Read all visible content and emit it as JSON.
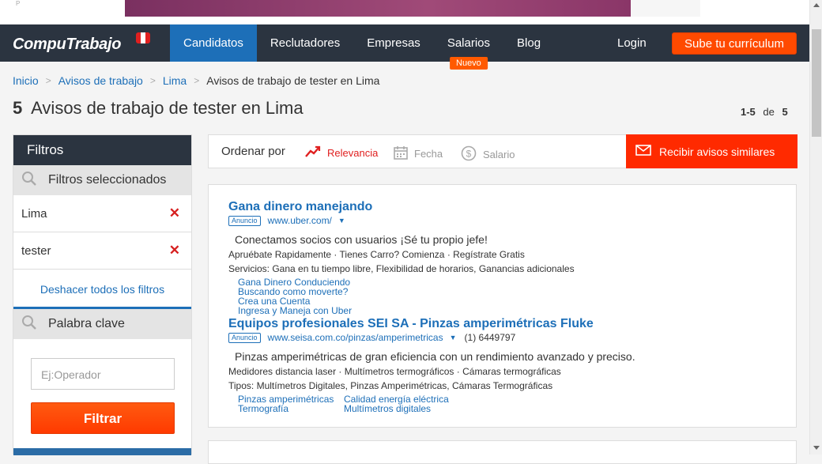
{
  "ad_banner": {
    "label": "P"
  },
  "nav": {
    "logo": "CompuTrabajo",
    "links": [
      {
        "label": "Candidatos"
      },
      {
        "label": "Reclutadores"
      },
      {
        "label": "Empresas"
      },
      {
        "label": "Salarios",
        "badge": "Nuevo"
      },
      {
        "label": "Blog"
      }
    ],
    "login": "Login",
    "cta": "Sube tu currículum"
  },
  "breadcrumb": {
    "items": [
      "Inicio",
      "Avisos de trabajo",
      "Lima"
    ],
    "separator": ">",
    "current": "Avisos de trabajo de tester en Lima"
  },
  "title": {
    "count": "5",
    "text": "Avisos de trabajo de tester en Lima"
  },
  "pager": {
    "range": "1-5",
    "of": "de",
    "total": "5"
  },
  "sidebar": {
    "heading": "Filtros",
    "selected_heading": "Filtros seleccionados",
    "selected_filters": [
      "Lima",
      "tester"
    ],
    "remove_icon": "✕",
    "undo_all": "Deshacer todos los filtros",
    "keyword_heading": "Palabra clave",
    "keyword_placeholder": "Ej:Operador",
    "filter_button": "Filtrar"
  },
  "sort": {
    "label": "Ordenar por",
    "options": [
      "Relevancia",
      "Fecha",
      "Salario"
    ],
    "active": "Relevancia",
    "alerts_button": "Recibir avisos similares"
  },
  "ads": [
    {
      "title": "Gana dinero manejando",
      "badge": "Anuncio",
      "url": "www.uber.com/",
      "description": "Conectamos socios con usuarios ¡Sé tu propio jefe!",
      "line1": "Apruébate Rapidamente · Tienes Carro? Comienza · Regístrate Gratis",
      "line2": "Servicios: Gana en tu tiempo libre, Flexibilidad de horarios, Ganancias adicionales",
      "sitelinks": [
        "Gana Dinero Conduciendo",
        "Buscando como moverte?",
        "Crea una Cuenta",
        "Ingresa y Maneja con Uber"
      ]
    },
    {
      "title": "Equipos profesionales SEI SA - Pinzas amperimétricas Fluke",
      "badge": "Anuncio",
      "url": "www.seisa.com.co/pinzas/amperimetricas",
      "phone": "(1) 6449797",
      "description": "Pinzas amperimétricas de gran eficiencia con un rendimiento avanzado y preciso.",
      "line1": "Medidores distancia laser · Multímetros termográficos · Cámaras termográficas",
      "line2": "Tipos: Multímetros Digitales, Pinzas Amperimétricas, Cámaras Termográficas",
      "sitelinks": [
        "Pinzas amperimétricas",
        "Calidad energía eléctrica",
        "Termografía",
        "Multímetros digitales"
      ]
    }
  ],
  "colors": {
    "nav_bg": "#2b3440",
    "accent_blue": "#1d6fb8",
    "cta_orange": "#ff4a00",
    "alert_red": "#ff2a00"
  }
}
